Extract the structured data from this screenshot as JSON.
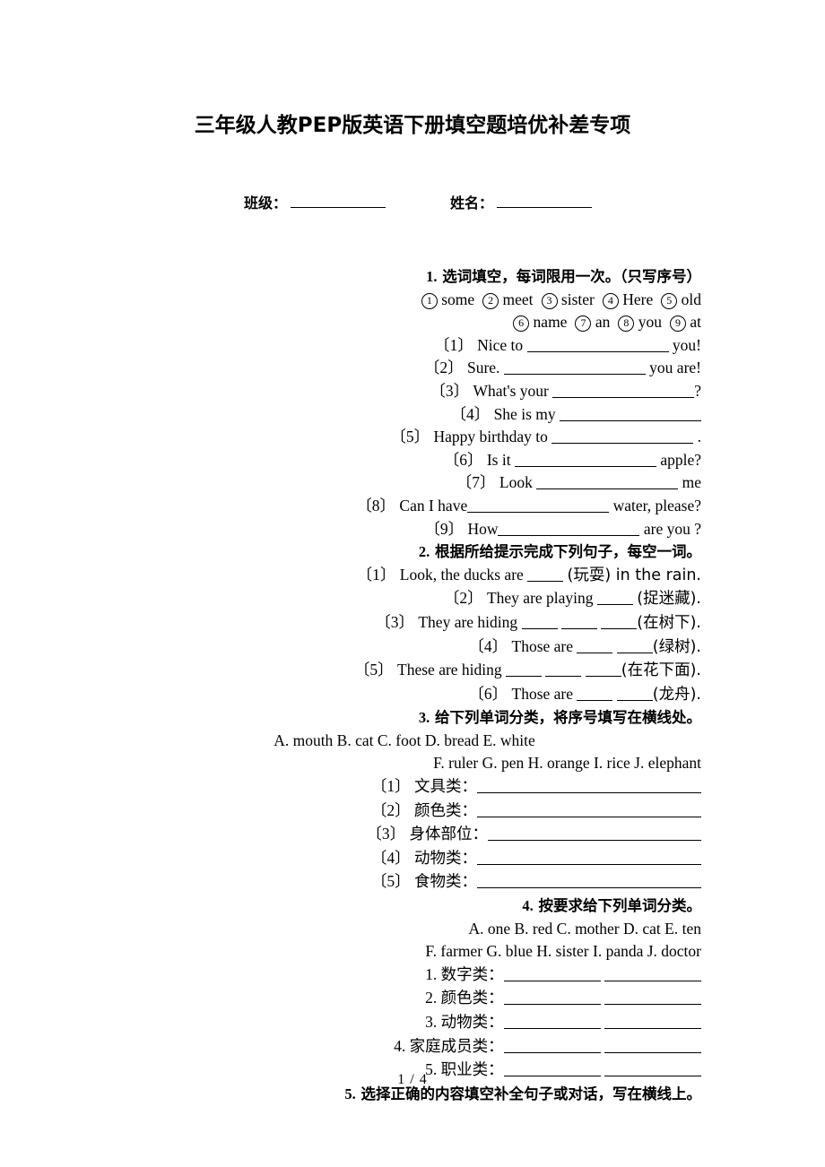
{
  "document": {
    "title": "三年级人教PEP版英语下册填空题培优补差专项",
    "page_footer": "1 / 4"
  },
  "header_fields": {
    "class_label": "班级：",
    "name_label": "姓名："
  },
  "sections": [
    {
      "id": "section-1",
      "number": "1.",
      "heading": "选词填空，每词限用一次。（只写序号）",
      "word_bank_line_1": [
        {
          "num": "1",
          "word": "some"
        },
        {
          "num": "2",
          "word": "meet"
        },
        {
          "num": "3",
          "word": "sister"
        },
        {
          "num": "4",
          "word": "Here"
        },
        {
          "num": "5",
          "word": "old"
        }
      ],
      "word_bank_line_2": [
        {
          "num": "6",
          "word": "name"
        },
        {
          "num": "7",
          "word": "an"
        },
        {
          "num": "8",
          "word": "you"
        },
        {
          "num": "9",
          "word": "at"
        }
      ],
      "items": [
        {
          "marker": "〔1〕",
          "before": "Nice to",
          "after": "you!"
        },
        {
          "marker": "〔2〕",
          "before": "Sure.",
          "after": "you are!"
        },
        {
          "marker": "〔3〕",
          "before": "What's your",
          "after": "?"
        },
        {
          "marker": "〔4〕",
          "before": "She is my",
          "after": ""
        },
        {
          "marker": "〔5〕",
          "before": "Happy birthday  to",
          "after": "."
        },
        {
          "marker": "〔6〕",
          "before": "Is it",
          "after": "apple?"
        },
        {
          "marker": "〔7〕",
          "before": "Look",
          "after": "me"
        },
        {
          "marker": "〔8〕",
          "before": "Can I have",
          "after": "water, please?"
        },
        {
          "marker": "〔9〕",
          "before": "How",
          "after": "are you ?"
        }
      ]
    },
    {
      "id": "section-2",
      "number": "2.",
      "heading": "根据所给提示完成下列句子，每空一词。",
      "items": [
        {
          "marker": "〔1〕",
          "before": "Look, the ducks are",
          "blanks": 1,
          "after": "(玩耍) in the rain."
        },
        {
          "marker": "〔2〕",
          "before": "They are playing",
          "blanks": 1,
          "after": "(捉迷藏)."
        },
        {
          "marker": "〔3〕",
          "before": "They are hiding",
          "blanks": 3,
          "after": "(在树下)."
        },
        {
          "marker": "〔4〕",
          "before": "Those are",
          "blanks": 2,
          "after": "(绿树)."
        },
        {
          "marker": "〔5〕",
          "before": "These are hiding",
          "blanks": 3,
          "after": "(在花下面)."
        },
        {
          "marker": "〔6〕",
          "before": "Those are",
          "blanks": 2,
          "after": "(龙舟)."
        }
      ]
    },
    {
      "id": "section-3",
      "number": "3.",
      "heading": "给下列单词分类，将序号填写在横线处。",
      "word_list_line_1": "A. mouth        B. cat       C. foot               D. bread        E. white",
      "word_list_line_2": "F. ruler   G. pen H. orange I. rice   J. elephant",
      "categories": [
        {
          "marker": "〔1〕",
          "label": "文具类："
        },
        {
          "marker": "〔2〕",
          "label": "颜色类："
        },
        {
          "marker": "〔3〕",
          "label": "身体部位："
        },
        {
          "marker": "〔4〕",
          "label": "动物类："
        },
        {
          "marker": "〔5〕",
          "label": "食物类："
        }
      ]
    },
    {
      "id": "section-4",
      "number": "4.",
      "heading": "按要求给下列单词分类。",
      "word_list_line_1": "A. one B. red   C. mother D. cat   E. ten",
      "word_list_line_2": "F. farmer G. blue H. sister   I. panda   J. doctor",
      "categories": [
        {
          "marker": "1.",
          "label": "数字类："
        },
        {
          "marker": "2.",
          "label": "颜色类："
        },
        {
          "marker": "3.",
          "label": "动物类："
        },
        {
          "marker": "4.",
          "label": "家庭成员类："
        },
        {
          "marker": "5.",
          "label": "职业类："
        }
      ]
    },
    {
      "id": "section-5",
      "number": "5.",
      "heading": "选择正确的内容填空补全句子或对话，写在横线上。"
    }
  ]
}
